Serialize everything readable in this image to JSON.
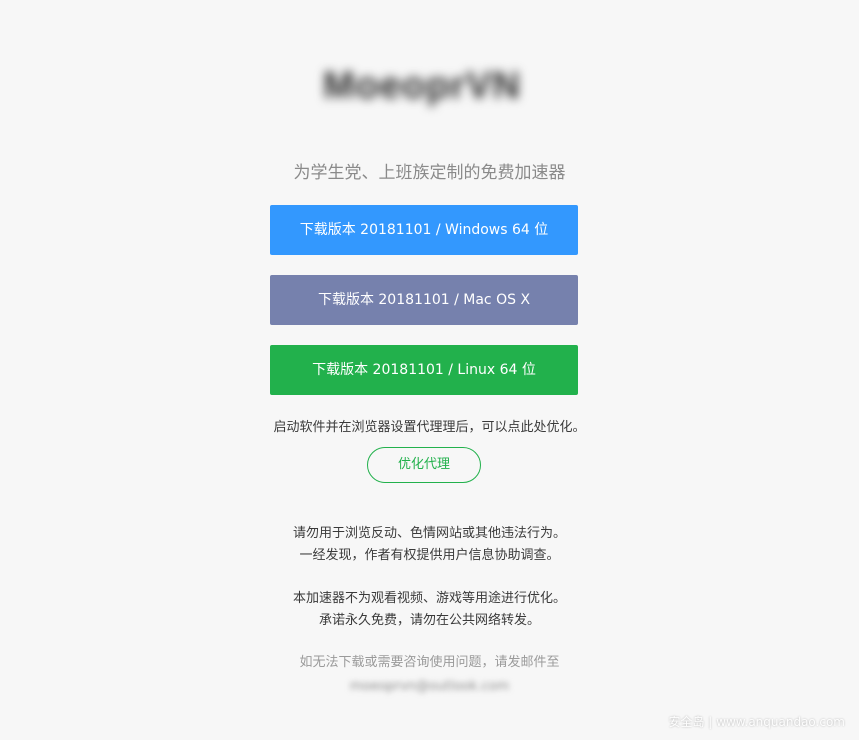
{
  "logo": {
    "text": "MoeoprVN"
  },
  "tagline": "为学生党、上班族定制的免费加速器",
  "downloads": {
    "windows": {
      "label": "下载版本 20181101 / Windows 64 位",
      "color": "#3398fe"
    },
    "mac": {
      "label": "下载版本 20181101 / Mac OS X",
      "color": "#7681ad"
    },
    "linux": {
      "label": "下载版本 20181101 / Linux 64 位",
      "color": "#22b14c"
    }
  },
  "hint": "启动软件并在浏览器设置代理理后，可以点此处优化。",
  "optimize_button": {
    "label": "优化代理",
    "color": "#22b14c"
  },
  "notices": {
    "line1": "请勿用于浏览反动、色情网站或其他违法行为。",
    "line2": "一经发现，作者有权提供用户信息协助调查。",
    "line3": "本加速器不为观看视频、游戏等用途进行优化。",
    "line4": "承诺永久免费，请勿在公共网络转发。"
  },
  "contact": {
    "text": "如无法下载或需要咨询使用问题，请发邮件至",
    "email": "moeoprvn@outlook.com"
  },
  "watermark": "安全岛 | www.anquandao.com"
}
